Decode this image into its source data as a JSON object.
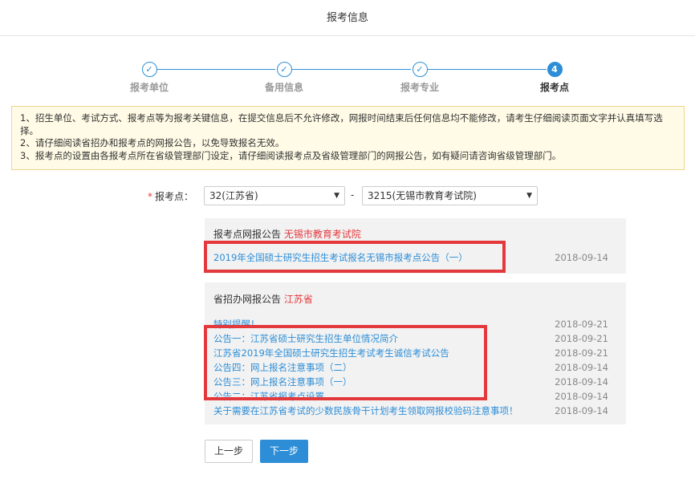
{
  "header": {
    "title": "报考信息"
  },
  "steps": [
    {
      "label": "报考单位",
      "marker": "✓",
      "active": false
    },
    {
      "label": "备用信息",
      "marker": "✓",
      "active": false
    },
    {
      "label": "报考专业",
      "marker": "✓",
      "active": false
    },
    {
      "label": "报考点",
      "marker": "4",
      "active": true
    }
  ],
  "notice": {
    "lines": [
      "1、招生单位、考试方式、报考点等为报考关键信息，在提交信息后不允许修改，网报时间结束后任何信息均不能修改，请考生仔细阅读页面文字并认真填写选择。",
      "2、请仔细阅读省招办和报考点的网报公告，以免导致报名无效。",
      "3、报考点的设置由各报考点所在省级管理部门设定，请仔细阅读报考点及省级管理部门的网报公告，如有疑问请咨询省级管理部门。"
    ]
  },
  "form": {
    "required_mark": "*",
    "label": "报考点：",
    "province_select": "32(江苏省)",
    "separator": "-",
    "site_select": "3215(无锡市教育考试院)"
  },
  "site_panel": {
    "title_prefix": "报考点网报公告",
    "title_highlight": "无锡市教育考试院",
    "items": [
      {
        "text": "2019年全国硕士研究生招生考试报名无锡市报考点公告（一）",
        "date": "2018-09-14"
      }
    ]
  },
  "province_panel": {
    "title_prefix": "省招办网报公告",
    "title_highlight": "江苏省",
    "items": [
      {
        "text": "特别提醒！",
        "date": "2018-09-21"
      },
      {
        "text": "公告一：江苏省硕士研究生招生单位情况简介",
        "date": "2018-09-21"
      },
      {
        "text": "江苏省2019年全国硕士研究生招生考试考生诚信考试公告",
        "date": "2018-09-21"
      },
      {
        "text": "公告四：网上报名注意事项（二）",
        "date": "2018-09-14"
      },
      {
        "text": "公告三：网上报名注意事项（一）",
        "date": "2018-09-14"
      },
      {
        "text": "公告二：江苏省报考点设置",
        "date": "2018-09-14"
      },
      {
        "text": "关于需要在江苏省考试的少数民族骨干计划考生领取网报校验码注意事项！",
        "date": "2018-09-14"
      }
    ]
  },
  "buttons": {
    "prev": "上一步",
    "next": "下一步"
  },
  "colors": {
    "accent": "#2d8ed7",
    "highlight": "#e4393c",
    "notice_bg": "#fffbe6",
    "panel_bg": "#f2f2f2"
  }
}
